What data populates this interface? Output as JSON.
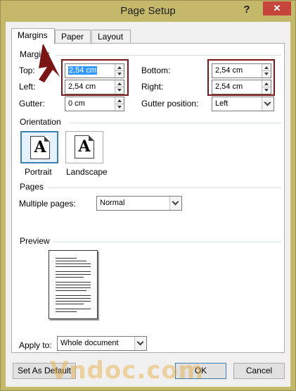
{
  "window": {
    "title": "Page Setup",
    "help": "?",
    "close": "✕"
  },
  "tabs": [
    {
      "label": "Margins",
      "active": true
    },
    {
      "label": "Paper",
      "active": false
    },
    {
      "label": "Layout",
      "active": false
    }
  ],
  "margins_group": {
    "label": "Margins",
    "top": {
      "label": "Top:",
      "value": "2,54 cm"
    },
    "bottom": {
      "label": "Bottom:",
      "value": "2,54 cm"
    },
    "left": {
      "label": "Left:",
      "value": "2,54 cm"
    },
    "right": {
      "label": "Right:",
      "value": "2,54 cm"
    },
    "gutter": {
      "label": "Gutter:",
      "value": "0 cm"
    },
    "gutter_position": {
      "label": "Gutter position:",
      "value": "Left"
    }
  },
  "orientation": {
    "label": "Orientation",
    "portrait": {
      "label": "Portrait",
      "glyph": "A",
      "selected": true
    },
    "landscape": {
      "label": "Landscape",
      "glyph": "A",
      "selected": false
    }
  },
  "pages": {
    "label": "Pages",
    "multiple_pages": {
      "label": "Multiple pages:",
      "value": "Normal"
    }
  },
  "preview": {
    "label": "Preview"
  },
  "apply_to": {
    "label": "Apply to:",
    "value": "Whole document"
  },
  "footer": {
    "set_default": "Set As Default",
    "ok": "OK",
    "cancel": "Cancel"
  },
  "watermark": "Vndoc.com",
  "colors": {
    "highlight_box": "#7b1616",
    "accent": "#3c7fb1",
    "selection": "#3399ff"
  }
}
